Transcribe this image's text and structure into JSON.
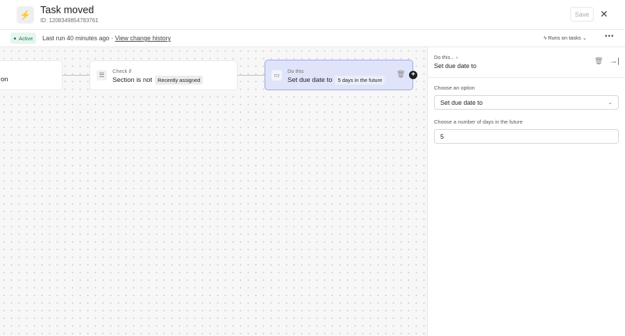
{
  "header": {
    "title": "Task moved",
    "id": "ID: 1208349854783761",
    "save_label": "Save"
  },
  "subheader": {
    "status": "Active",
    "last_run": "Last run 40 minutes ago ·",
    "history_link": "View change history",
    "runs_on": "Runs on tasks"
  },
  "canvas": {
    "trigger_card": {
      "text": "on"
    },
    "check_card": {
      "label": "Check if",
      "text": "Section is not",
      "chip": "Recently assigned"
    },
    "action_card": {
      "label": "Do this",
      "text": "Set due date to",
      "chip": "5 days in the future"
    }
  },
  "panel": {
    "breadcrumb": "Do this...",
    "title": "Set due date to",
    "option_label": "Choose an option",
    "option_value": "Set due date to",
    "days_label": "Choose a number of days in the future",
    "days_value": "5"
  },
  "colors": {
    "action_bg": "#e0e4fa",
    "action_border": "#9aa5e0",
    "active_green": "#1f7a4e"
  }
}
